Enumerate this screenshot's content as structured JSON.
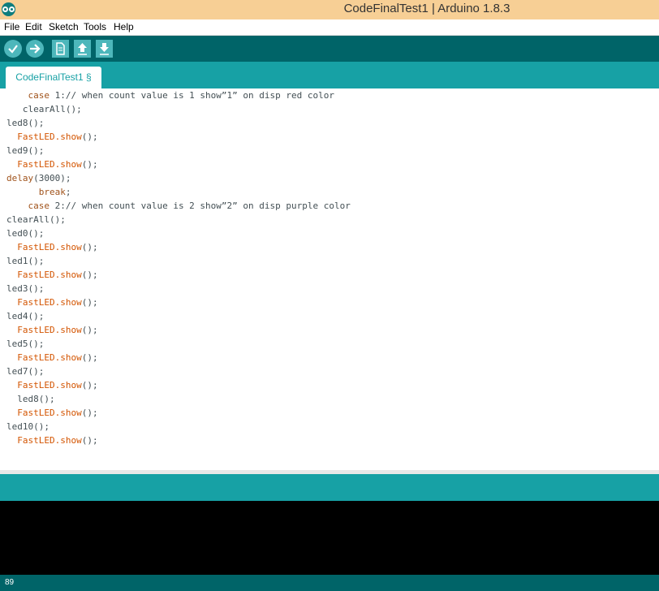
{
  "window": {
    "title": "CodeFinalTest1 | Arduino 1.8.3",
    "app_icon": "arduino-logo-icon"
  },
  "menu": {
    "items": [
      "File",
      "Edit",
      "Sketch",
      "Tools",
      "Help"
    ]
  },
  "toolbar": {
    "buttons": [
      {
        "name": "verify",
        "icon": "checkmark-icon"
      },
      {
        "name": "upload",
        "icon": "arrow-right-icon"
      },
      {
        "name": "new",
        "icon": "new-file-icon"
      },
      {
        "name": "open",
        "icon": "arrow-up-icon"
      },
      {
        "name": "save",
        "icon": "arrow-down-icon"
      }
    ]
  },
  "tabs": [
    {
      "label": "CodeFinalTest1 §",
      "active": true
    }
  ],
  "editor": {
    "lines": [
      {
        "indent": "    ",
        "parts": [
          {
            "t": "case",
            "c": "kw-brown"
          },
          {
            "t": " 1:// when count value is 1 show”1” on disp red color",
            "c": ""
          }
        ]
      },
      {
        "indent": "   ",
        "parts": [
          {
            "t": "clearAll();",
            "c": ""
          }
        ]
      },
      {
        "indent": "",
        "parts": [
          {
            "t": "led8();",
            "c": ""
          }
        ]
      },
      {
        "indent": "  ",
        "parts": [
          {
            "t": "FastLED.show",
            "c": "kw-orange"
          },
          {
            "t": "();",
            "c": ""
          }
        ]
      },
      {
        "indent": "",
        "parts": [
          {
            "t": "led9();",
            "c": ""
          }
        ]
      },
      {
        "indent": "  ",
        "parts": [
          {
            "t": "FastLED.show",
            "c": "kw-orange"
          },
          {
            "t": "();",
            "c": ""
          }
        ]
      },
      {
        "indent": "",
        "parts": [
          {
            "t": "delay",
            "c": "kw-brown"
          },
          {
            "t": "(3000);",
            "c": ""
          }
        ]
      },
      {
        "indent": "      ",
        "parts": [
          {
            "t": "break",
            "c": "kw-brown"
          },
          {
            "t": ";",
            "c": ""
          }
        ]
      },
      {
        "indent": "    ",
        "parts": [
          {
            "t": "case",
            "c": "kw-brown"
          },
          {
            "t": " 2:// when count value is 2 show”2” on disp purple color",
            "c": ""
          }
        ]
      },
      {
        "indent": "",
        "parts": [
          {
            "t": "clearAll();",
            "c": ""
          }
        ]
      },
      {
        "indent": "",
        "parts": [
          {
            "t": "led0();",
            "c": ""
          }
        ]
      },
      {
        "indent": "  ",
        "parts": [
          {
            "t": "FastLED.show",
            "c": "kw-orange"
          },
          {
            "t": "();",
            "c": ""
          }
        ]
      },
      {
        "indent": "",
        "parts": [
          {
            "t": "led1();",
            "c": ""
          }
        ]
      },
      {
        "indent": "  ",
        "parts": [
          {
            "t": "FastLED.show",
            "c": "kw-orange"
          },
          {
            "t": "();",
            "c": ""
          }
        ]
      },
      {
        "indent": "",
        "parts": [
          {
            "t": "led3();",
            "c": ""
          }
        ]
      },
      {
        "indent": "  ",
        "parts": [
          {
            "t": "FastLED.show",
            "c": "kw-orange"
          },
          {
            "t": "();",
            "c": ""
          }
        ]
      },
      {
        "indent": "",
        "parts": [
          {
            "t": "led4();",
            "c": ""
          }
        ]
      },
      {
        "indent": "  ",
        "parts": [
          {
            "t": "FastLED.show",
            "c": "kw-orange"
          },
          {
            "t": "();",
            "c": ""
          }
        ]
      },
      {
        "indent": "",
        "parts": [
          {
            "t": "led5();",
            "c": ""
          }
        ]
      },
      {
        "indent": "  ",
        "parts": [
          {
            "t": "FastLED.show",
            "c": "kw-orange"
          },
          {
            "t": "();",
            "c": ""
          }
        ]
      },
      {
        "indent": "",
        "parts": [
          {
            "t": "led7();",
            "c": ""
          }
        ]
      },
      {
        "indent": "  ",
        "parts": [
          {
            "t": "FastLED.show",
            "c": "kw-orange"
          },
          {
            "t": "();",
            "c": ""
          }
        ]
      },
      {
        "indent": "  ",
        "parts": [
          {
            "t": "led8();",
            "c": ""
          }
        ]
      },
      {
        "indent": "  ",
        "parts": [
          {
            "t": "FastLED.show",
            "c": "kw-orange"
          },
          {
            "t": "();",
            "c": ""
          }
        ]
      },
      {
        "indent": "",
        "parts": [
          {
            "t": "led10();",
            "c": ""
          }
        ]
      },
      {
        "indent": "  ",
        "parts": [
          {
            "t": "FastLED.show",
            "c": "kw-orange"
          },
          {
            "t": "();",
            "c": ""
          }
        ]
      }
    ]
  },
  "status": {
    "line_number": "89"
  },
  "colors": {
    "toolbar": "#006468",
    "tabbar": "#17a1a5",
    "titlebar": "#f7cf95",
    "keyword_orange": "#d35400",
    "keyword_brown": "#a0521a"
  }
}
